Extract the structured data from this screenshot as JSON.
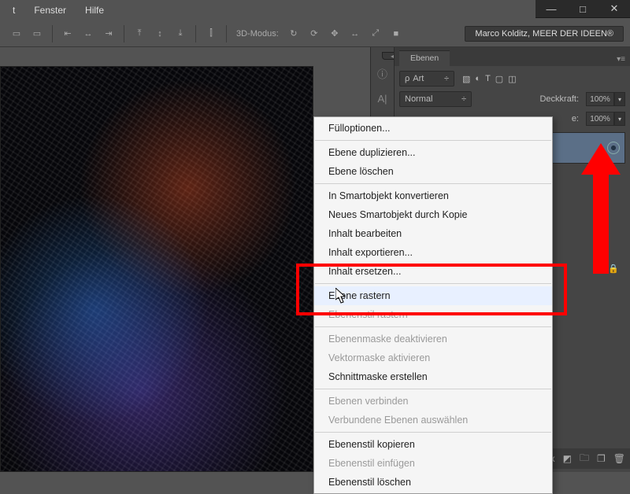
{
  "menubar": {
    "trunc": "t",
    "fenster": "Fenster",
    "hilfe": "Hilfe"
  },
  "window": {
    "min": "—",
    "max": "□",
    "close": "✕"
  },
  "toolbar": {
    "mode3d_label": "3D-Modus:",
    "user_label": "Marco Kolditz, MEER DER IDEEN®"
  },
  "panels": {
    "ebenen_tab": "Ebenen",
    "filter": "Art",
    "blend": "Normal",
    "deckkraft_label": "Deckkraft:",
    "deckkraft_val": "100%",
    "second_label": "e:",
    "second_val": "100%"
  },
  "ctx": {
    "items": [
      {
        "t": "Fülloptionen...",
        "en": true
      },
      {
        "sep": true
      },
      {
        "t": "Ebene duplizieren...",
        "en": true
      },
      {
        "t": "Ebene löschen",
        "en": true
      },
      {
        "sep": true
      },
      {
        "t": "In Smartobjekt konvertieren",
        "en": true
      },
      {
        "t": "Neues Smartobjekt durch Kopie",
        "en": true
      },
      {
        "t": "Inhalt bearbeiten",
        "en": true
      },
      {
        "t": "Inhalt exportieren...",
        "en": true
      },
      {
        "t": "Inhalt ersetzen...",
        "en": true
      },
      {
        "sep": true
      },
      {
        "t": "Ebene rastern",
        "en": true,
        "hover": true
      },
      {
        "t": "Ebenenstil rastern",
        "en": false
      },
      {
        "sep": true
      },
      {
        "t": "Ebenenmaske deaktivieren",
        "en": false
      },
      {
        "t": "Vektormaske aktivieren",
        "en": false
      },
      {
        "t": "Schnittmaske erstellen",
        "en": true
      },
      {
        "sep": true
      },
      {
        "t": "Ebenen verbinden",
        "en": false
      },
      {
        "t": "Verbundene Ebenen auswählen",
        "en": false
      },
      {
        "sep": true
      },
      {
        "t": "Ebenenstil kopieren",
        "en": true
      },
      {
        "t": "Ebenenstil einfügen",
        "en": false
      },
      {
        "t": "Ebenenstil löschen",
        "en": true
      }
    ]
  }
}
